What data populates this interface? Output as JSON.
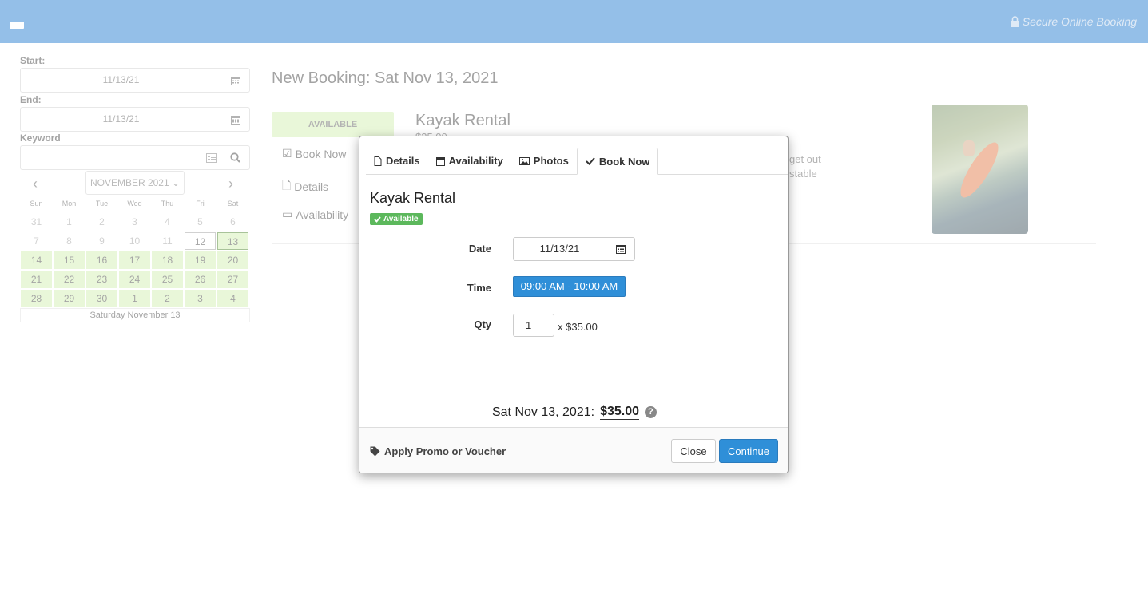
{
  "header": {
    "secure_label": "Secure Online Booking"
  },
  "filters": {
    "start_label": "Start:",
    "start_value": "11/13/21",
    "end_label": "End:",
    "end_value": "11/13/21",
    "keyword_label": "Keyword",
    "keyword_value": ""
  },
  "calendar": {
    "month": "NOVEMBER 2021",
    "weekdays": [
      "Sun",
      "Mon",
      "Tue",
      "Wed",
      "Thu",
      "Fri",
      "Sat"
    ],
    "days": [
      {
        "d": "31",
        "s": "off"
      },
      {
        "d": "1",
        "s": "off"
      },
      {
        "d": "2",
        "s": "off"
      },
      {
        "d": "3",
        "s": "off"
      },
      {
        "d": "4",
        "s": "off"
      },
      {
        "d": "5",
        "s": "off"
      },
      {
        "d": "6",
        "s": "off"
      },
      {
        "d": "7",
        "s": "off"
      },
      {
        "d": "8",
        "s": "off"
      },
      {
        "d": "9",
        "s": "off"
      },
      {
        "d": "10",
        "s": "off"
      },
      {
        "d": "11",
        "s": "off"
      },
      {
        "d": "12",
        "s": "today"
      },
      {
        "d": "13",
        "s": "sel"
      },
      {
        "d": "14",
        "s": "av"
      },
      {
        "d": "15",
        "s": "av"
      },
      {
        "d": "16",
        "s": "av"
      },
      {
        "d": "17",
        "s": "av"
      },
      {
        "d": "18",
        "s": "av"
      },
      {
        "d": "19",
        "s": "av"
      },
      {
        "d": "20",
        "s": "av"
      },
      {
        "d": "21",
        "s": "av"
      },
      {
        "d": "22",
        "s": "av"
      },
      {
        "d": "23",
        "s": "av"
      },
      {
        "d": "24",
        "s": "av"
      },
      {
        "d": "25",
        "s": "av"
      },
      {
        "d": "26",
        "s": "av"
      },
      {
        "d": "27",
        "s": "av"
      },
      {
        "d": "28",
        "s": "av"
      },
      {
        "d": "29",
        "s": "av"
      },
      {
        "d": "30",
        "s": "av"
      },
      {
        "d": "1",
        "s": "av"
      },
      {
        "d": "2",
        "s": "av"
      },
      {
        "d": "3",
        "s": "av"
      },
      {
        "d": "4",
        "s": "av"
      }
    ],
    "footer": "Saturday November 13"
  },
  "background": {
    "page_title": "New Booking: Sat Nov 13, 2021",
    "availability_badge": "AVAILABLE",
    "side_links": [
      "Book Now",
      "Details",
      "Availability"
    ],
    "product_title": "Kayak Rental",
    "product_price": "$35.00",
    "desc_line1": "get out",
    "desc_line2": "stable"
  },
  "modal": {
    "tabs": [
      "Details",
      "Availability",
      "Photos",
      "Book Now"
    ],
    "title": "Kayak Rental",
    "badge": "Available",
    "date_label": "Date",
    "date_value": "11/13/21",
    "time_label": "Time",
    "time_value": "09:00 AM - 10:00 AM",
    "qty_label": "Qty",
    "qty_value": "1",
    "qty_price": "x $35.00",
    "total_label": "Sat Nov 13, 2021:",
    "total_amount": "$35.00",
    "help": "?",
    "promo_label": "Apply Promo or Voucher",
    "close_label": "Close",
    "continue_label": "Continue"
  }
}
